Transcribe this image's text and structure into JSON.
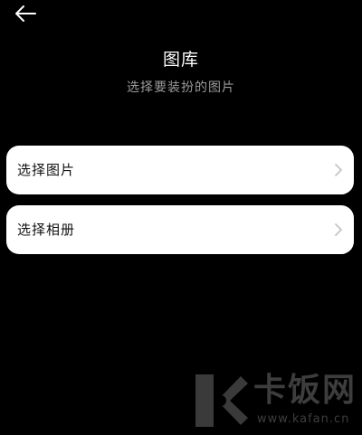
{
  "header": {
    "back_icon": "arrow-left-icon",
    "title": "图库",
    "subtitle": "选择要装扮的图片"
  },
  "options": [
    {
      "label": "选择图片",
      "icon": "chevron-right-icon"
    },
    {
      "label": "选择相册",
      "icon": "chevron-right-icon"
    }
  ],
  "watermark": {
    "brand": "卡饭网",
    "domain": "www.kafan.cn"
  },
  "colors": {
    "background": "#000000",
    "card": "#ffffff",
    "title": "#ffffff",
    "subtitle": "#9a9a9a",
    "chevron": "#c4c4c4"
  }
}
